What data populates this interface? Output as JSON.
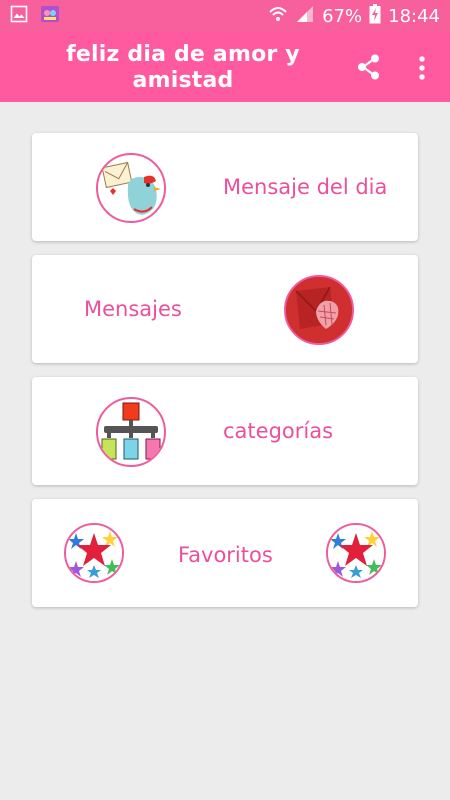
{
  "status_bar": {
    "battery": "67%",
    "time": "18:44",
    "icons": [
      "image-icon",
      "notification-app-icon",
      "wifi-icon",
      "signal-icon",
      "battery-charging-icon"
    ]
  },
  "app_bar": {
    "title": "feliz dia de amor y amistad",
    "actions": [
      "share-icon",
      "more-vert-icon"
    ]
  },
  "menu": [
    {
      "label": "Mensaje del dia",
      "icon": "love-letter-bird-icon"
    },
    {
      "label": "Mensajes",
      "icon": "heart-envelope-icon"
    },
    {
      "label": "categorías",
      "icon": "categories-hierarchy-icon"
    },
    {
      "label": "Favoritos",
      "icon": "stars-icon"
    }
  ],
  "colors": {
    "status_bar": "#f7609c",
    "app_bar": "#ff5aa0",
    "accent_text": "#ec4f9c",
    "background": "#ececec"
  }
}
